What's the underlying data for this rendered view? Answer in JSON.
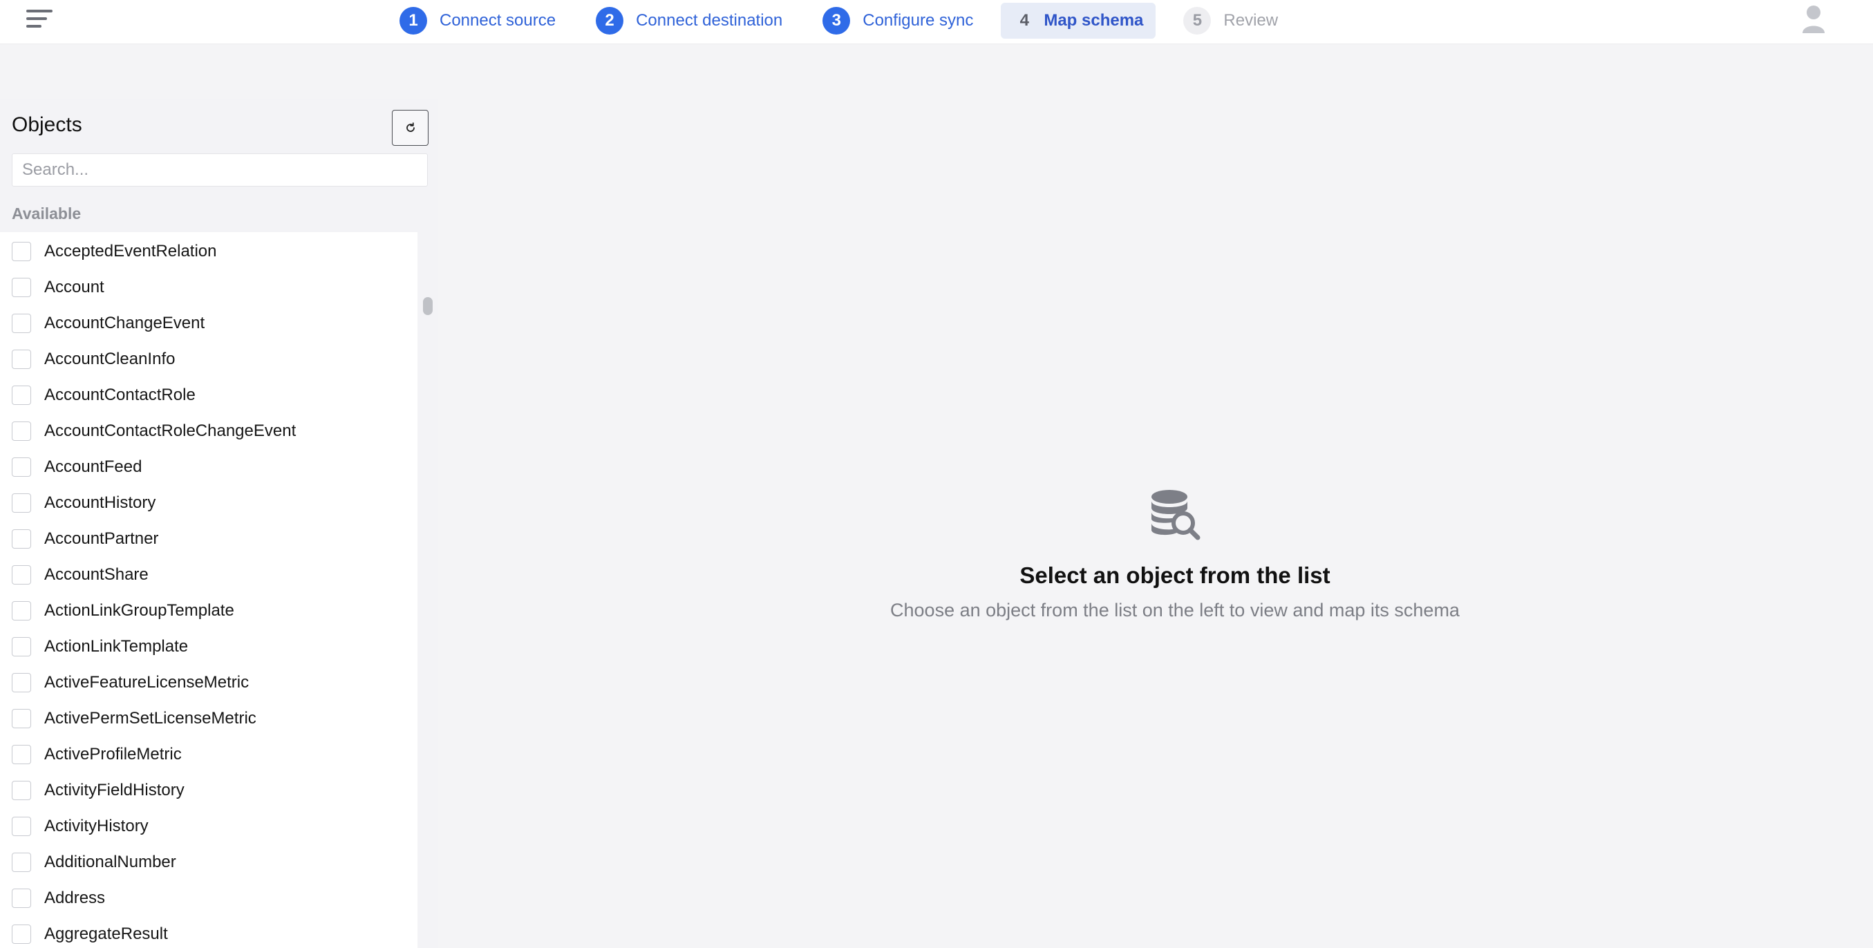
{
  "header": {
    "menu_icon": "hamburger-menu-icon",
    "avatar_icon": "user-avatar-icon",
    "steps": [
      {
        "number": "1",
        "label": "Connect source",
        "state": "complete"
      },
      {
        "number": "2",
        "label": "Connect destination",
        "state": "complete"
      },
      {
        "number": "3",
        "label": "Configure sync",
        "state": "complete"
      },
      {
        "number": "4",
        "label": "Map schema",
        "state": "active"
      },
      {
        "number": "5",
        "label": "Review",
        "state": "upcoming"
      }
    ]
  },
  "objects_panel": {
    "title": "Objects",
    "refresh_icon": "refresh-icon",
    "search_placeholder": "Search...",
    "section_label": "Available",
    "items": [
      "AcceptedEventRelation",
      "Account",
      "AccountChangeEvent",
      "AccountCleanInfo",
      "AccountContactRole",
      "AccountContactRoleChangeEvent",
      "AccountFeed",
      "AccountHistory",
      "AccountPartner",
      "AccountShare",
      "ActionLinkGroupTemplate",
      "ActionLinkTemplate",
      "ActiveFeatureLicenseMetric",
      "ActivePermSetLicenseMetric",
      "ActiveProfileMetric",
      "ActivityFieldHistory",
      "ActivityHistory",
      "AdditionalNumber",
      "Address",
      "AggregateResult"
    ]
  },
  "empty_state": {
    "icon": "database-search-icon",
    "title": "Select an object from the list",
    "subtitle": "Choose an object from the list on the left to view and map its schema"
  },
  "colors": {
    "accent": "#2f6be8",
    "active_step_bg": "#e7ecf7",
    "page_bg": "#f4f4f6"
  }
}
